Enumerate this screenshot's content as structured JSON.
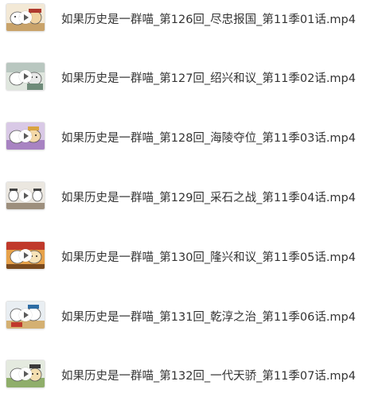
{
  "files": [
    {
      "name": "如果历史是一群喵_第126回_尽忠报国_第11季01话.mp4",
      "thumb_icon": "video-thumbnail-icon"
    },
    {
      "name": "如果历史是一群喵_第127回_绍兴和议_第11季02话.mp4",
      "thumb_icon": "video-thumbnail-icon"
    },
    {
      "name": "如果历史是一群喵_第128回_海陵夺位_第11季03话.mp4",
      "thumb_icon": "video-thumbnail-icon"
    },
    {
      "name": "如果历史是一群喵_第129回_采石之战_第11季04话.mp4",
      "thumb_icon": "video-thumbnail-icon"
    },
    {
      "name": "如果历史是一群喵_第130回_隆兴和议_第11季05话.mp4",
      "thumb_icon": "video-thumbnail-icon"
    },
    {
      "name": "如果历史是一群喵_第131回_乾淳之治_第11季06话.mp4",
      "thumb_icon": "video-thumbnail-icon"
    },
    {
      "name": "如果历史是一群喵_第132回_一代天骄_第11季07话.mp4",
      "thumb_icon": "video-thumbnail-icon"
    }
  ],
  "colors": {
    "text": "#333333",
    "background": "#ffffff"
  }
}
